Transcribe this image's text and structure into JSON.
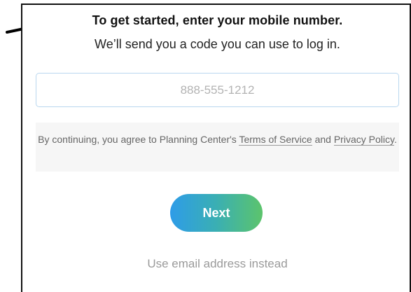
{
  "header": {
    "title": "To get started, enter your mobile number.",
    "subtitle": "We’ll send you a code you can use to log in."
  },
  "phone": {
    "placeholder": "888-555-1212",
    "value": ""
  },
  "terms": {
    "prefix": "By continuing, you agree to Planning Center's ",
    "terms_link": "Terms of Service",
    "middle": " and ",
    "privacy_link": "Privacy Policy",
    "suffix": "."
  },
  "next_button": {
    "label": "Next"
  },
  "alt_login": {
    "label": "Use email address instead"
  },
  "colors": {
    "button_gradient_start": "#2e9ce8",
    "button_gradient_end": "#5cc46c",
    "input_border": "#b9d7ef",
    "terms_background": "#f6f6f6"
  },
  "icons": [
    "arrow-right-icon",
    "arrow-right-icon"
  ]
}
